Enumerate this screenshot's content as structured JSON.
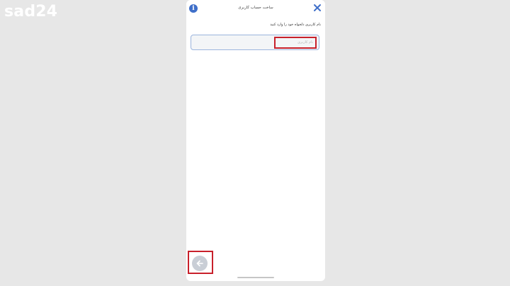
{
  "watermark": {
    "text": "sad24"
  },
  "header": {
    "title": "ساخت حساب کاربری",
    "info_icon": "info-icon",
    "info_glyph": "i",
    "close_icon": "close-icon"
  },
  "form": {
    "prompt": "نام کاربری دلخواه خود را وارد کنید",
    "username": {
      "value": "",
      "placeholder": "نام کاربری"
    }
  },
  "footer": {
    "back_icon": "arrow-left-icon"
  },
  "colors": {
    "accent": "#3f6fc9",
    "highlight": "#c8202b",
    "input_border": "#9bb4dd",
    "back_button_bg": "#c9ced6"
  }
}
